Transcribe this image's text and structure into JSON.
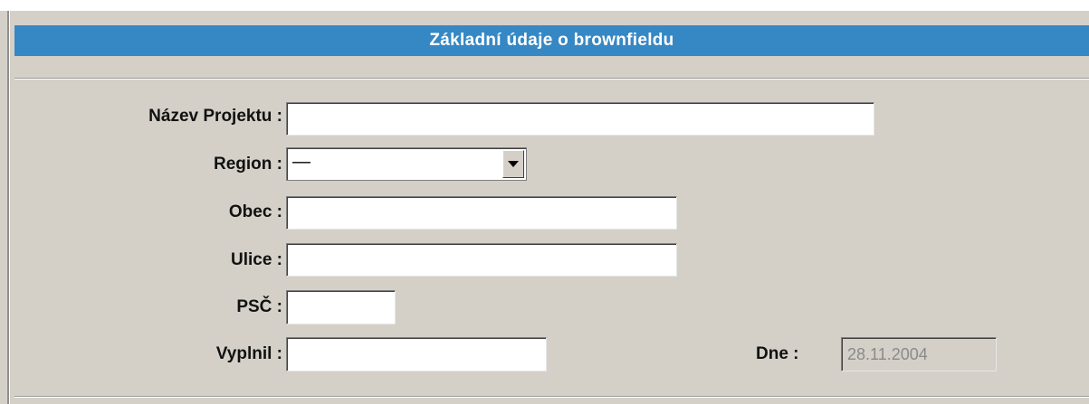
{
  "header": {
    "title": "Základní údaje o brownfieldu"
  },
  "form": {
    "project_name": {
      "label": "Název Projektu :",
      "value": ""
    },
    "region": {
      "label": "Region :",
      "value": "—"
    },
    "obec": {
      "label": "Obec :",
      "value": ""
    },
    "ulice": {
      "label": "Ulice :",
      "value": ""
    },
    "psc": {
      "label": "PSČ :",
      "value": ""
    },
    "vyplnil": {
      "label": "Vyplnil :",
      "value": ""
    },
    "dne": {
      "label": "Dne :",
      "value": "28.11.2004"
    }
  }
}
